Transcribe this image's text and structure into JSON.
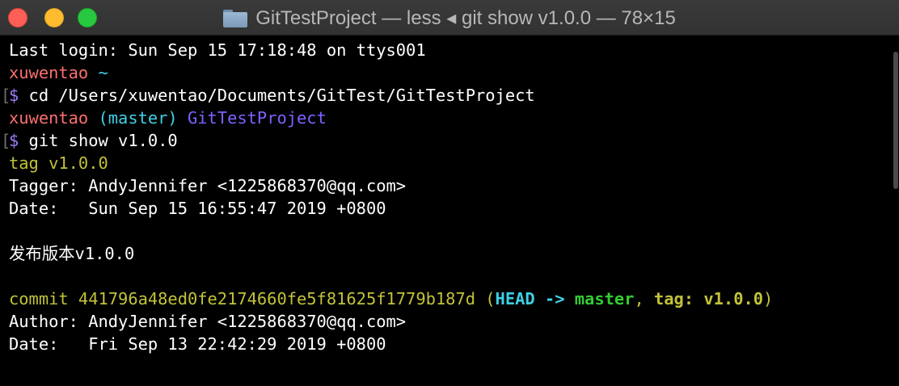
{
  "window": {
    "title": "GitTestProject — less ◂ git show v1.0.0 — 78×15",
    "folder_icon": "folder-icon"
  },
  "colors": {
    "white": "#ffffff",
    "red": "#fb6f6f",
    "cyan": "#3fd0e6",
    "purple": "#8060ff",
    "yellow": "#c2c23a",
    "green": "#33cc33",
    "dollar_purple": "#9f7df7"
  },
  "lines": [
    {
      "segments": [
        {
          "text": "Last login: Sun Sep 15 17:18:48 on ttys001",
          "color": "#ffffff",
          "bold": false
        }
      ]
    },
    {
      "segments": [
        {
          "text": "xuwentao",
          "color": "#fb6f6f",
          "bold": false
        },
        {
          "text": " ~",
          "color": "#3fd0e6",
          "bold": false
        }
      ]
    },
    {
      "bracket": true,
      "segments": [
        {
          "text": "$",
          "color": "#9f7df7",
          "bold": false
        },
        {
          "text": " cd /Users/xuwentao/Documents/GitTest/GitTestProject",
          "color": "#ffffff",
          "bold": false
        }
      ]
    },
    {
      "segments": [
        {
          "text": "xuwentao",
          "color": "#fb6f6f",
          "bold": false
        },
        {
          "text": " (master)",
          "color": "#3fd0e6",
          "bold": false
        },
        {
          "text": " GitTestProject",
          "color": "#8060ff",
          "bold": false
        }
      ]
    },
    {
      "bracket": true,
      "segments": [
        {
          "text": "$",
          "color": "#9f7df7",
          "bold": false
        },
        {
          "text": " git show v1.0.0",
          "color": "#ffffff",
          "bold": false
        }
      ]
    },
    {
      "segments": [
        {
          "text": "tag v1.0.0",
          "color": "#c2c23a",
          "bold": false
        }
      ]
    },
    {
      "segments": [
        {
          "text": "Tagger: AndyJennifer <1225868370@qq.com>",
          "color": "#ffffff",
          "bold": false
        }
      ]
    },
    {
      "segments": [
        {
          "text": "Date:   Sun Sep 15 16:55:47 2019 +0800",
          "color": "#ffffff",
          "bold": false
        }
      ]
    },
    {
      "segments": [
        {
          "text": "",
          "color": "#ffffff",
          "bold": false
        }
      ]
    },
    {
      "segments": [
        {
          "text": "发布版本v1.0.0",
          "color": "#ffffff",
          "bold": false
        }
      ]
    },
    {
      "segments": [
        {
          "text": "",
          "color": "#ffffff",
          "bold": false
        }
      ]
    },
    {
      "segments": [
        {
          "text": "commit 441796a48ed0fe2174660fe5f81625f1779b187d (",
          "color": "#c2c23a",
          "bold": false
        },
        {
          "text": "HEAD -> ",
          "color": "#3fd0e6",
          "bold": true
        },
        {
          "text": "master",
          "color": "#33cc33",
          "bold": true
        },
        {
          "text": ", ",
          "color": "#c2c23a",
          "bold": false
        },
        {
          "text": "tag: v1.0.0",
          "color": "#c2c23a",
          "bold": true
        },
        {
          "text": ")",
          "color": "#c2c23a",
          "bold": false
        }
      ]
    },
    {
      "segments": [
        {
          "text": "Author: AndyJennifer <1225868370@qq.com>",
          "color": "#ffffff",
          "bold": false
        }
      ]
    },
    {
      "segments": [
        {
          "text": "Date:   Fri Sep 13 22:42:29 2019 +0800",
          "color": "#ffffff",
          "bold": false
        }
      ]
    }
  ],
  "gutter": {
    "bracket_char": "["
  }
}
